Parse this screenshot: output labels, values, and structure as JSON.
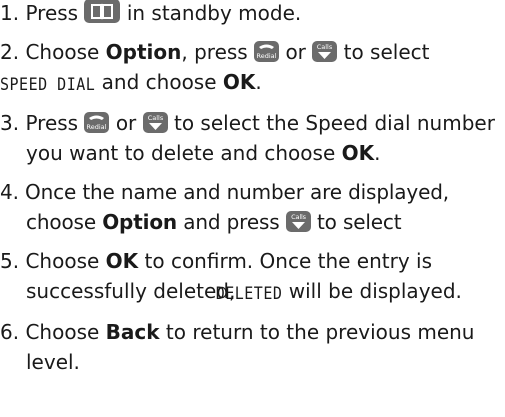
{
  "steps": [
    {
      "num": "1.",
      "before": "Press",
      "after": "in standby mode.",
      "icons": {
        "phonebook": "phonebook-key-icon"
      }
    },
    {
      "num": "2.",
      "t1": "Choose",
      "b1": "Option",
      "t2": ", press",
      "t3": "or",
      "t4": "to select",
      "lcd": "SPEED DIAL",
      "t5": "and choose",
      "b2": "OK",
      "t6": ".",
      "icons": {
        "redial": "redial-key-icon",
        "calls": "calls-key-icon"
      },
      "icon_text": {
        "redial": "Redial",
        "calls": "Calls"
      }
    },
    {
      "num": "3.",
      "t1": "Press",
      "t2": "or",
      "t3": "to select the Speed dial number you want to delete and choose",
      "b1": "OK",
      "t4": ".",
      "icons": {
        "redial": "redial-key-icon",
        "calls": "calls-key-icon"
      },
      "icon_text": {
        "redial": "Redial",
        "calls": "Calls"
      }
    },
    {
      "num": "4.",
      "t1": "Once the name and number are displayed, choose",
      "b1": "Option",
      "t2": "and press",
      "t3": "to select",
      "icons": {
        "calls": "calls-key-icon"
      },
      "icon_text": {
        "calls": "Calls"
      }
    },
    {
      "num": "5.",
      "t1": "Choose",
      "b1": "OK",
      "t2": "to confirm.  Once the entry is successfully deleted,",
      "lcd": "DELETED",
      "t3": "will be displayed."
    },
    {
      "num": "6.",
      "t1": "Choose",
      "b1": "Back",
      "t2": "to return to the previous menu level."
    }
  ],
  "colors": {
    "text": "#1a1a1a",
    "key_fill": "#6b6b6b",
    "key_glyph": "#ffffff"
  }
}
